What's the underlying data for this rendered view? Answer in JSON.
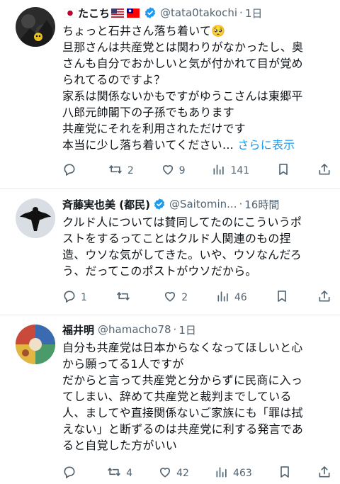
{
  "tweets": [
    {
      "name": "たこち",
      "handle": "@tata0takochi",
      "dot": "·",
      "time": "1日",
      "lines": [
        "ちょっと石井さん落ち着いて🥺",
        "旦那さんは共産党とは関わりがなかったし、奥",
        "さんも自分でおかしいと気が付かれて目が覚め",
        "られてるのですよ？",
        "家系は関係ないかもですがゆうこさんは東郷平",
        "八郎元帥閣下の子孫でもあります",
        "共産党にそれを利用されただけです"
      ],
      "last_line": "本当に少し落ち着いてください…",
      "more_label": "さらに表示",
      "stats": {
        "replies": "",
        "reposts": "2",
        "likes": "9",
        "views": "141"
      }
    },
    {
      "name": "斉藤実也美 (都民)",
      "handle": "@Saitomin...",
      "dot": "·",
      "time": "16時間",
      "lines": [
        "クルド人については賛同してたのにこういうポ",
        "ストをするってことはクルド人関連のもの捏",
        "造、ウソな気がしてきた。いや、ウソなんだろ",
        "う、だってこのポストがウソだから。"
      ],
      "stats": {
        "replies": "1",
        "reposts": "",
        "likes": "2",
        "views": "46"
      }
    },
    {
      "name": "福井明",
      "handle": "@hamacho78",
      "dot": "·",
      "time": "1日",
      "lines": [
        "自分も共産党は日本からなくなってほしいと心",
        "から願ってる1人ですが",
        "だからと言って共産党と分からずに民商に入っ",
        "てしまい、辞めて共産党と裁判までしている",
        "人、ましてや直接関係ないご家族にも「罪は拭",
        "えない」と断ずるのは共産党に利する発言であ",
        "ると自覚した方がいい"
      ],
      "stats": {
        "replies": "",
        "reposts": "4",
        "likes": "42",
        "views": "463"
      }
    }
  ]
}
